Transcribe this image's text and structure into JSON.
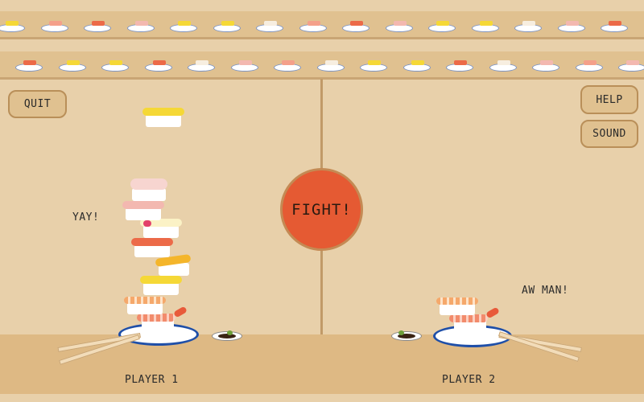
{
  "buttons": {
    "quit": "QUIT",
    "help": "HELP",
    "sound": "SOUND",
    "fight": "FIGHT!"
  },
  "players": {
    "p1": {
      "label": "PLAYER 1",
      "reaction": "YAY!",
      "stack_count": 8
    },
    "p2": {
      "label": "PLAYER 2",
      "reaction": "AW MAN!",
      "stack_count": 2
    }
  },
  "colors": {
    "background": "#e8d0aa",
    "belt": "#e0c190",
    "fight_button": "#e55a33",
    "plate_rim": "#1f4fa8"
  },
  "conveyor_top_toppings": [
    "tamago",
    "shrimp",
    "salmon",
    "tuna",
    "tamago",
    "tamago",
    "squid",
    "shrimp",
    "salmon",
    "tuna",
    "tamago",
    "tamago",
    "squid",
    "tuna",
    "salmon"
  ],
  "conveyor_bottom_toppings": [
    "salmon",
    "tamago",
    "tamago",
    "salmon",
    "squid",
    "tuna",
    "shrimp",
    "squid",
    "tamago",
    "tamago",
    "salmon",
    "squid",
    "tuna",
    "shrimp",
    "tuna"
  ]
}
